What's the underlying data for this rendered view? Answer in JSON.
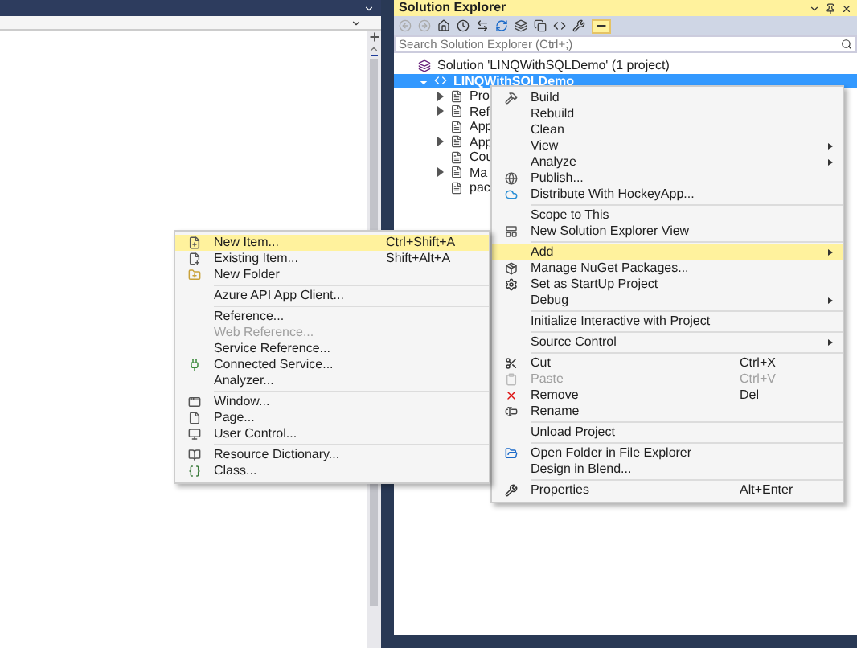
{
  "solution_explorer": {
    "title": "Solution Explorer",
    "search": {
      "placeholder": "Search Solution Explorer (Ctrl+;)"
    },
    "tree": [
      {
        "label": "Solution 'LINQWithSQLDemo' (1 project)",
        "selected": false,
        "children": [
          {
            "label": "LINQWithSQLDemo",
            "selected": true,
            "expanded": true,
            "children": [
              {
                "label": "Pro",
                "expandable": true
              },
              {
                "label": "Ref",
                "expandable": true
              },
              {
                "label": "App",
                "expandable": false
              },
              {
                "label": "App",
                "expandable": true
              },
              {
                "label": "Cou",
                "expandable": false
              },
              {
                "label": "Ma",
                "expandable": true
              },
              {
                "label": "pac",
                "expandable": false
              }
            ]
          }
        ]
      }
    ]
  },
  "context_menu": {
    "groups": [
      [
        {
          "label": "Build",
          "selected": false,
          "disabled": false
        },
        {
          "label": "Rebuild",
          "selected": false,
          "disabled": false
        },
        {
          "label": "Clean",
          "selected": false,
          "disabled": false
        },
        {
          "label": "View",
          "submenu": true,
          "selected": false,
          "disabled": false
        },
        {
          "label": "Analyze",
          "submenu": true,
          "selected": false,
          "disabled": false
        },
        {
          "label": "Publish...",
          "selected": false,
          "disabled": false
        },
        {
          "label": "Distribute With HockeyApp...",
          "selected": false,
          "disabled": false
        }
      ],
      [
        {
          "label": "Scope to This",
          "selected": false,
          "disabled": false
        },
        {
          "label": "New Solution Explorer View",
          "selected": false,
          "disabled": false
        }
      ],
      [
        {
          "label": "Add",
          "submenu": true,
          "selected": true,
          "disabled": false
        },
        {
          "label": "Manage NuGet Packages...",
          "selected": false,
          "disabled": false
        },
        {
          "label": "Set as StartUp Project",
          "selected": false,
          "disabled": false
        },
        {
          "label": "Debug",
          "submenu": true,
          "selected": false,
          "disabled": false
        }
      ],
      [
        {
          "label": "Initialize Interactive with Project",
          "selected": false,
          "disabled": false
        }
      ],
      [
        {
          "label": "Source Control",
          "submenu": true,
          "selected": false,
          "disabled": false
        }
      ],
      [
        {
          "label": "Cut",
          "shortcut": "Ctrl+X",
          "selected": false,
          "disabled": false
        },
        {
          "label": "Paste",
          "shortcut": "Ctrl+V",
          "selected": false,
          "disabled": true
        },
        {
          "label": "Remove",
          "shortcut": "Del",
          "selected": false,
          "disabled": false
        },
        {
          "label": "Rename",
          "selected": false,
          "disabled": false
        }
      ],
      [
        {
          "label": "Unload Project",
          "selected": false,
          "disabled": false
        }
      ],
      [
        {
          "label": "Open Folder in File Explorer",
          "selected": false,
          "disabled": false
        },
        {
          "label": "Design in Blend...",
          "selected": false,
          "disabled": false
        }
      ],
      [
        {
          "label": "Properties",
          "shortcut": "Alt+Enter",
          "selected": false,
          "disabled": false
        }
      ]
    ]
  },
  "add_submenu": {
    "groups": [
      [
        {
          "label": "New Item...",
          "shortcut": "Ctrl+Shift+A",
          "selected": true,
          "disabled": false
        },
        {
          "label": "Existing Item...",
          "shortcut": "Shift+Alt+A",
          "selected": false,
          "disabled": false
        },
        {
          "label": "New Folder",
          "selected": false,
          "disabled": false
        }
      ],
      [
        {
          "label": "Azure API App Client...",
          "selected": false,
          "disabled": false
        }
      ],
      [
        {
          "label": "Reference...",
          "selected": false,
          "disabled": false
        },
        {
          "label": "Web Reference...",
          "selected": false,
          "disabled": true
        },
        {
          "label": "Service Reference...",
          "selected": false,
          "disabled": false
        },
        {
          "label": "Connected Service...",
          "selected": false,
          "disabled": false
        },
        {
          "label": "Analyzer...",
          "selected": false,
          "disabled": false
        }
      ],
      [
        {
          "label": "Window...",
          "selected": false,
          "disabled": false
        },
        {
          "label": "Page...",
          "selected": false,
          "disabled": false
        },
        {
          "label": "User Control...",
          "selected": false,
          "disabled": false
        }
      ],
      [
        {
          "label": "Resource Dictionary...",
          "selected": false,
          "disabled": false
        },
        {
          "label": "Class...",
          "selected": false,
          "disabled": false
        }
      ]
    ]
  }
}
